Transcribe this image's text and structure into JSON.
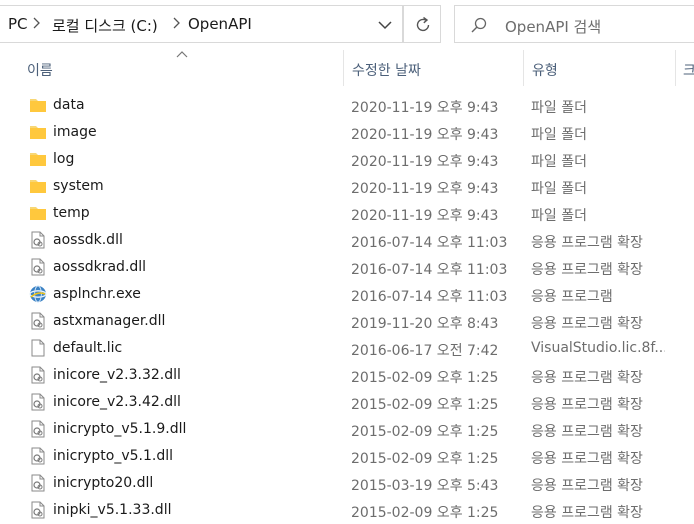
{
  "addressbar": {
    "crumbs": [
      "PC",
      "로컬 디스크 (C:)",
      "OpenAPI"
    ]
  },
  "search": {
    "placeholder": "OpenAPI 검색"
  },
  "columns": {
    "name": "이름",
    "date": "수정한 날짜",
    "type": "유형",
    "size": "크"
  },
  "files": [
    {
      "name": "data",
      "date": "2020-11-19 오후 9:43",
      "type": "파일 폴더",
      "icon": "folder-icon"
    },
    {
      "name": "image",
      "date": "2020-11-19 오후 9:43",
      "type": "파일 폴더",
      "icon": "folder-icon"
    },
    {
      "name": "log",
      "date": "2020-11-19 오후 9:43",
      "type": "파일 폴더",
      "icon": "folder-icon"
    },
    {
      "name": "system",
      "date": "2020-11-19 오후 9:43",
      "type": "파일 폴더",
      "icon": "folder-icon"
    },
    {
      "name": "temp",
      "date": "2020-11-19 오후 9:43",
      "type": "파일 폴더",
      "icon": "folder-icon"
    },
    {
      "name": "aossdk.dll",
      "date": "2016-07-14 오후 11:03",
      "type": "응용 프로그램 확장",
      "icon": "dll-file-icon"
    },
    {
      "name": "aossdkrad.dll",
      "date": "2016-07-14 오후 11:03",
      "type": "응용 프로그램 확장",
      "icon": "dll-file-icon"
    },
    {
      "name": "asplnchr.exe",
      "date": "2016-07-14 오후 11:03",
      "type": "응용 프로그램",
      "icon": "exe-globe-icon"
    },
    {
      "name": "astxmanager.dll",
      "date": "2019-11-20 오후 8:43",
      "type": "응용 프로그램 확장",
      "icon": "dll-file-icon"
    },
    {
      "name": "default.lic",
      "date": "2016-06-17 오전 7:42",
      "type": "VisualStudio.lic.8f...",
      "icon": "blank-file-icon"
    },
    {
      "name": "inicore_v2.3.32.dll",
      "date": "2015-02-09 오후 1:25",
      "type": "응용 프로그램 확장",
      "icon": "dll-file-icon"
    },
    {
      "name": "inicore_v2.3.42.dll",
      "date": "2015-02-09 오후 1:25",
      "type": "응용 프로그램 확장",
      "icon": "dll-file-icon"
    },
    {
      "name": "inicrypto_v5.1.9.dll",
      "date": "2015-02-09 오후 1:25",
      "type": "응용 프로그램 확장",
      "icon": "dll-file-icon"
    },
    {
      "name": "inicrypto_v5.1.dll",
      "date": "2015-02-09 오후 1:25",
      "type": "응용 프로그램 확장",
      "icon": "dll-file-icon"
    },
    {
      "name": "inicrypto20.dll",
      "date": "2015-03-19 오후 5:43",
      "type": "응용 프로그램 확장",
      "icon": "dll-file-icon"
    },
    {
      "name": "inipki_v5.1.33.dll",
      "date": "2015-02-09 오후 1:25",
      "type": "응용 프로그램 확장",
      "icon": "dll-file-icon"
    }
  ]
}
